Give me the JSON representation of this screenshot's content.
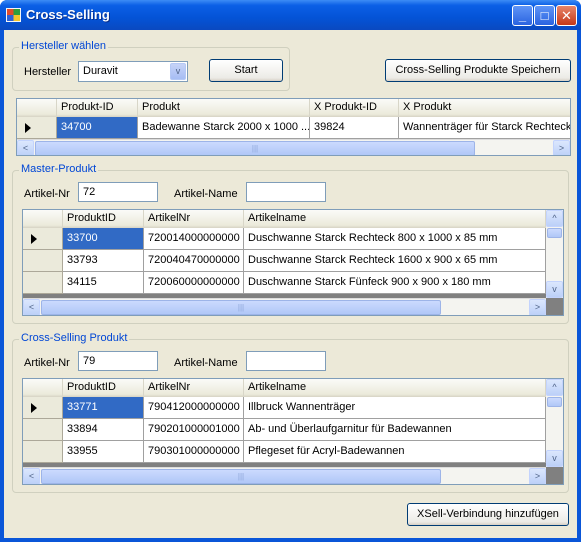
{
  "window": {
    "title": "Cross-Selling",
    "minimize_glyph": "_",
    "maximize_glyph": "□",
    "close_glyph": "✕"
  },
  "hersteller_group": {
    "title": "Hersteller wählen",
    "hersteller_label": "Hersteller",
    "hersteller_value": "Duravit",
    "start_button": "Start"
  },
  "save_button": "Cross-Selling Produkte Speichern",
  "top_grid": {
    "columns": [
      "Produkt-ID",
      "Produkt",
      "X Produkt-ID",
      "X Produkt"
    ],
    "rows": [
      [
        "34700",
        "Badewanne Starck 2000 x 1000 ...",
        "39824",
        "Wannenträger für Starck Rechteck"
      ]
    ]
  },
  "master_group": {
    "title": "Master-Produkt",
    "artikel_nr_label": "Artikel-Nr",
    "artikel_nr_value": "72",
    "artikel_name_label": "Artikel-Name",
    "artikel_name_value": "",
    "columns": [
      "ProduktID",
      "ArtikelNr",
      "Artikelname"
    ],
    "rows": [
      [
        "33700",
        "720014000000000",
        "Duschwanne Starck Rechteck 800 x 1000 x 85 mm"
      ],
      [
        "33793",
        "720040470000000",
        "Duschwanne Starck Rechteck 1600 x 900 x 65 mm"
      ],
      [
        "34115",
        "720060000000000",
        "Duschwanne Starck Fünfeck 900 x 900 x 180 mm"
      ]
    ]
  },
  "cross_group": {
    "title": "Cross-Selling Produkt",
    "artikel_nr_label": "Artikel-Nr",
    "artikel_nr_value": "79",
    "artikel_name_label": "Artikel-Name",
    "artikel_name_value": "",
    "columns": [
      "ProduktID",
      "ArtikelNr",
      "Artikelname"
    ],
    "rows": [
      [
        "33771",
        "790412000000000",
        "Illbruck Wannenträger"
      ],
      [
        "33894",
        "790201000001000",
        "Ab- und Überlaufgarnitur für Badewannen"
      ],
      [
        "33955",
        "790301000000000",
        "Pflegeset für Acryl-Badewannen"
      ]
    ]
  },
  "add_button": "XSell-Verbindung hinzufügen",
  "scroll_glyphs": {
    "left": "<",
    "right": ">",
    "up": "^",
    "down": "v",
    "grip": "|||"
  },
  "colors": {
    "selection": "#316ac5",
    "group_title": "#0046d5",
    "titlebar": "#0453d6"
  }
}
